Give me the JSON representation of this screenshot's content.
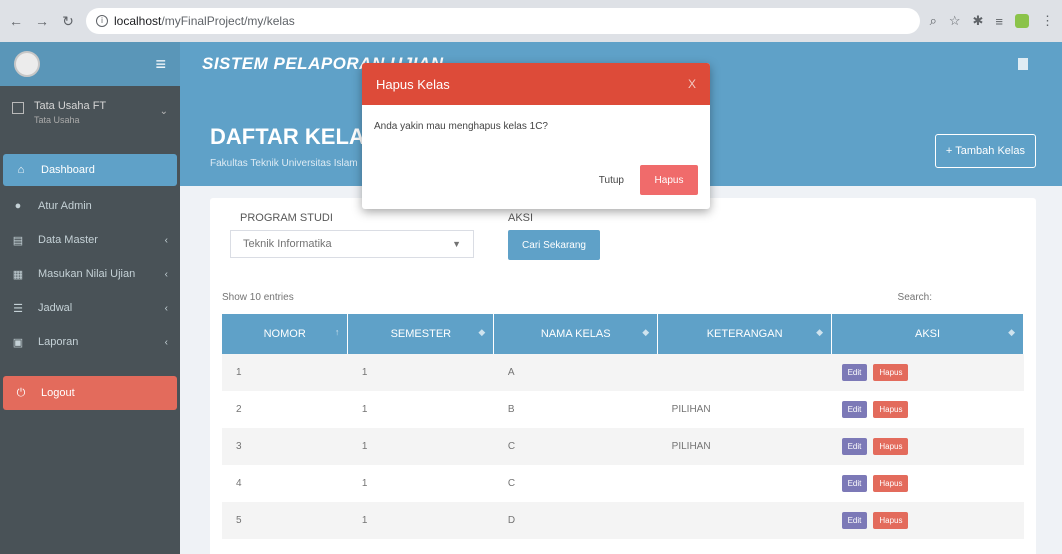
{
  "browser": {
    "url_host": "localhost",
    "url_path": "/myFinalProject/my/kelas"
  },
  "header": {
    "app_title": "SISTEM PELAPORAN UJIAN"
  },
  "user": {
    "name": "Tata Usaha FT",
    "role": "Tata Usaha"
  },
  "sidebar": {
    "items": [
      {
        "label": "Dashboard"
      },
      {
        "label": "Atur Admin"
      },
      {
        "label": "Data Master"
      },
      {
        "label": "Masukan Nilai Ujian"
      },
      {
        "label": "Jadwal"
      },
      {
        "label": "Laporan"
      },
      {
        "label": "Logout"
      }
    ]
  },
  "page": {
    "title": "DAFTAR KELAS",
    "subtitle": "Fakultas Teknik Universitas Islam",
    "add_button": "Tambah Kelas"
  },
  "filter": {
    "program_label": "PROGRAM STUDI",
    "program_value": "Teknik Informatika",
    "aksi_label": "AKSI",
    "cari_button": "Cari Sekarang"
  },
  "table": {
    "show_text": "Show 10 entries",
    "search_text": "Search:",
    "headers": [
      "NOMOR",
      "SEMESTER",
      "NAMA KELAS",
      "KETERANGAN",
      "AKSI"
    ],
    "edit_label": "Edit",
    "hapus_label": "Hapus",
    "rows": [
      {
        "nomor": "1",
        "semester": "1",
        "kelas": "A",
        "keterangan": ""
      },
      {
        "nomor": "2",
        "semester": "1",
        "kelas": "B",
        "keterangan": "PILIHAN"
      },
      {
        "nomor": "3",
        "semester": "1",
        "kelas": "C",
        "keterangan": "PILIHAN"
      },
      {
        "nomor": "4",
        "semester": "1",
        "kelas": "C",
        "keterangan": ""
      },
      {
        "nomor": "5",
        "semester": "1",
        "kelas": "D",
        "keterangan": ""
      }
    ]
  },
  "modal": {
    "title": "Hapus Kelas",
    "close": "X",
    "message": "Anda yakin mau menghapus kelas 1C?",
    "tutup": "Tutup",
    "hapus": "Hapus"
  },
  "colors": {
    "primary": "#3c8dbc",
    "danger": "#dd4b39",
    "sidebar": "#222d32"
  }
}
